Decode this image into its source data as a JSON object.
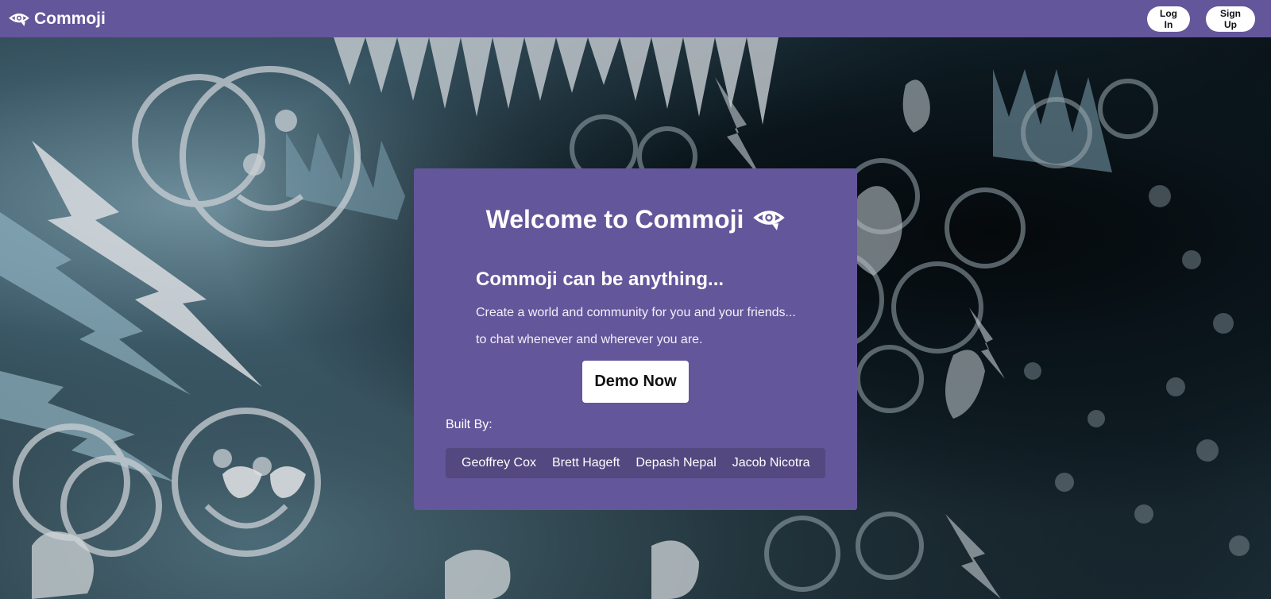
{
  "colors": {
    "brand": "#64569a",
    "authors_bar": "#53487f",
    "button_bg": "#ffffff"
  },
  "navbar": {
    "brand_icon": "eye-icon",
    "brand_name": "Commoji",
    "login_label": "Log In",
    "signup_label": "Sign Up"
  },
  "card": {
    "title": "Welcome to Commoji",
    "title_icon": "eye-icon",
    "tagline": "Commoji can be anything...",
    "description_line1": "Create a world and community for you and your friends...",
    "description_line2": "to chat whenever and wherever you are.",
    "demo_label": "Demo Now",
    "built_by_label": "Built By:",
    "authors": [
      "Geoffrey Cox",
      "Brett Hageft",
      "Depash Nepal",
      "Jacob Nicotra"
    ]
  }
}
